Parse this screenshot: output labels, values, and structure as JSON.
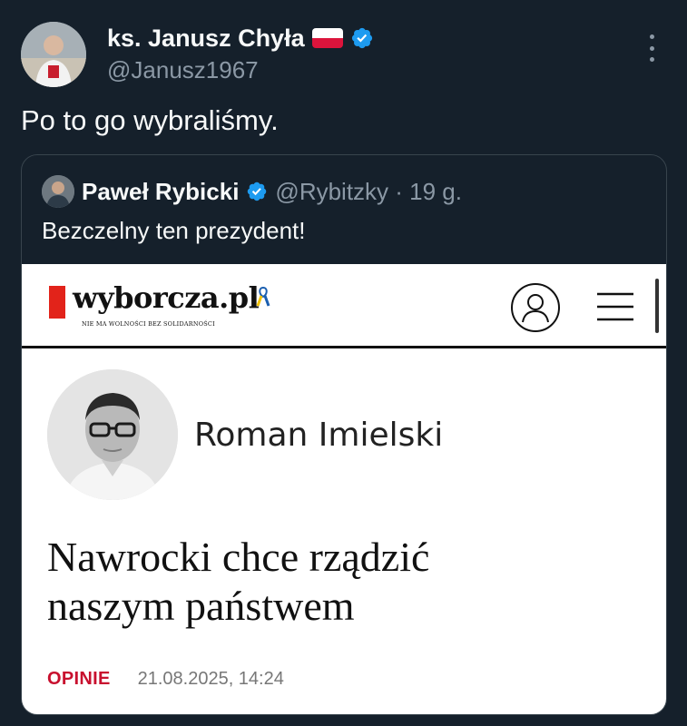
{
  "tweet": {
    "author_name": "ks. Janusz Chyła",
    "author_handle": "@Janusz1967",
    "text": "Po to go wybraliśmy.",
    "flag_icon": "poland-flag-icon",
    "verified_icon": "verified-badge-icon",
    "more_icon": "more-options-icon"
  },
  "quoted_tweet": {
    "author_name": "Paweł Rybicki",
    "author_handle": "@Rybitzky · 19 g.",
    "text": "Bezczelny ten prezydent!"
  },
  "article": {
    "site_logo": "wyborcza.pl",
    "site_tagline": "NIE MA WOLNOŚCI BEZ SOLIDARNOŚCI",
    "author": "Roman Imielski",
    "headline_line1": "Nawrocki chce rządzić",
    "headline_line2": "naszym państwem",
    "section": "OPINIE",
    "date": "21.08.2025, 14:24"
  },
  "colors": {
    "background": "#15202b",
    "text_primary": "#f7f9f9",
    "text_secondary": "#8b98a5",
    "verified_blue": "#1d9bf0",
    "border": "#38444d",
    "logo_red": "#e2231a",
    "section_red": "#c8102e"
  }
}
